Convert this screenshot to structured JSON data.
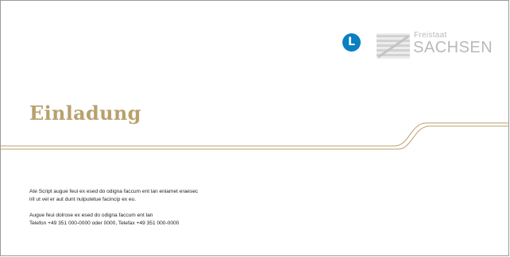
{
  "header": {
    "logo_letter": "L",
    "state_logo_small": "Freistaat",
    "state_logo_big": "SACHSEN"
  },
  "title": "Einladung",
  "body": {
    "paragraph1_line1": "Ate Script augue feui ex esed do odigna faccum ent lan eniamet eraesec",
    "paragraph1_line2": "iril ut vel er aut dunt nulputetue facincip ex eu.",
    "paragraph2_line1": "Augue feui dolrose ex esed do odigna faccum ent lan",
    "paragraph2_line2": "Telefon +49 351 000-0000 oder 0000, Telefax +49 351 000-0000"
  },
  "colors": {
    "accent_gold": "#b9a06c",
    "logo_blue": "#0a7fc3",
    "logo_grey": "#b9b9b9"
  },
  "icons": {
    "logo_l": "blue-circle-letter-l",
    "state_crest": "saxony-crest-stripes"
  }
}
